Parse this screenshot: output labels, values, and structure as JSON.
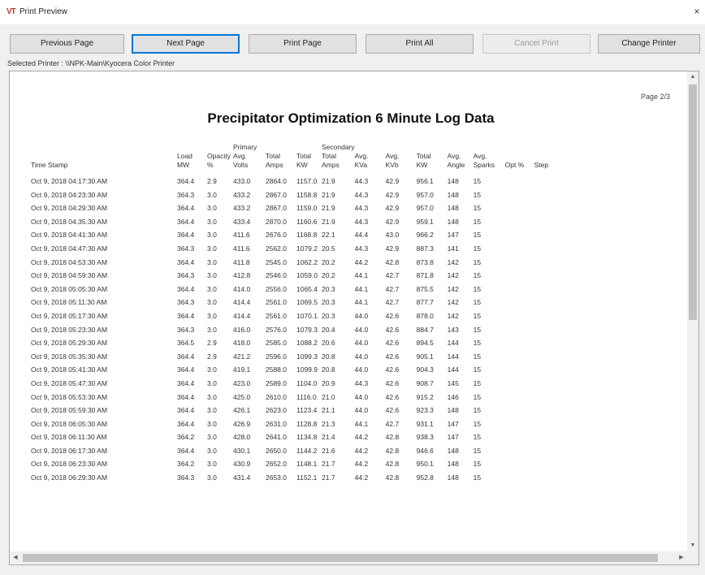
{
  "window": {
    "title": "Print Preview",
    "icon_text": "VT",
    "close_glyph": "×"
  },
  "toolbar": {
    "previous_label": "Previous Page",
    "next_label": "Next Page",
    "print_page_label": "Print Page",
    "print_all_label": "Print All",
    "cancel_print_label": "Cancel Print",
    "change_printer_label": "Change Printer"
  },
  "printer": {
    "selected_label": "Selected Printer : \\\\NPK-Main\\Kyocera Color Printer"
  },
  "report": {
    "page_label": "Page 2/3",
    "title": "Precipitator Optimization 6 Minute Log Data",
    "group_headers": {
      "primary": "Primary",
      "secondary": "Secondary"
    },
    "columns": [
      [
        "",
        "",
        "Time Stamp"
      ],
      [
        "",
        "Load",
        "MW"
      ],
      [
        "",
        "Opacity",
        "%"
      ],
      [
        "Primary",
        "Avg.",
        "Volts"
      ],
      [
        "",
        "Total",
        "Amps"
      ],
      [
        "",
        "Total",
        "KW"
      ],
      [
        "Secondary",
        "Total",
        "Amps"
      ],
      [
        "",
        "Avg.",
        "KVa"
      ],
      [
        "",
        "Avg.",
        "KVb"
      ],
      [
        "",
        "Total",
        "KW"
      ],
      [
        "",
        "Avg.",
        "Angle"
      ],
      [
        "",
        "Avg.",
        "Sparks"
      ],
      [
        "",
        "",
        "Opt %"
      ],
      [
        "",
        "",
        "Step"
      ]
    ],
    "rows": [
      [
        "Oct 9, 2018 04:17:30 AM",
        "364.4",
        "2.9",
        "433.0",
        "2864.0",
        "1157.0",
        "21.9",
        "44.3",
        "42.9",
        "956.1",
        "148",
        "15",
        "",
        ""
      ],
      [
        "Oct 9, 2018 04:23:30 AM",
        "364.3",
        "3.0",
        "433.2",
        "2867.0",
        "1158.8",
        "21.9",
        "44.3",
        "42.9",
        "957.0",
        "148",
        "15",
        "",
        ""
      ],
      [
        "Oct 9, 2018 04:29:30 AM",
        "364.4",
        "3.0",
        "433.2",
        "2867.0",
        "1159.0",
        "21.9",
        "44.3",
        "42.9",
        "957.0",
        "148",
        "15",
        "",
        ""
      ],
      [
        "Oct 9, 2018 04:35:30 AM",
        "364.4",
        "3.0",
        "433.4",
        "2870.0",
        "1160.6",
        "21.9",
        "44.3",
        "42.9",
        "959.1",
        "148",
        "15",
        "",
        ""
      ],
      [
        "Oct 9, 2018 04:41:30 AM",
        "364.4",
        "3.0",
        "411.6",
        "2676.0",
        "1168.8",
        "22.1",
        "44.4",
        "43.0",
        "966.2",
        "147",
        "15",
        "",
        ""
      ],
      [
        "Oct 9, 2018 04:47:30 AM",
        "364.3",
        "3.0",
        "411.6",
        "2562.0",
        "1079.2",
        "20.5",
        "44.3",
        "42.9",
        "887.3",
        "141",
        "15",
        "",
        ""
      ],
      [
        "Oct 9, 2018 04:53:30 AM",
        "364.4",
        "3.0",
        "411.8",
        "2545.0",
        "1062.2",
        "20.2",
        "44.2",
        "42.8",
        "873.8",
        "142",
        "15",
        "",
        ""
      ],
      [
        "Oct 9, 2018 04:59:30 AM",
        "364.3",
        "3.0",
        "412.8",
        "2546.0",
        "1059.0",
        "20.2",
        "44.1",
        "42.7",
        "871.8",
        "142",
        "15",
        "",
        ""
      ],
      [
        "Oct 9, 2018 05:05:30 AM",
        "364.4",
        "3.0",
        "414.0",
        "2556.0",
        "1065.4",
        "20.3",
        "44.1",
        "42.7",
        "875.5",
        "142",
        "15",
        "",
        ""
      ],
      [
        "Oct 9, 2018 05:11:30 AM",
        "364.3",
        "3.0",
        "414.4",
        "2561.0",
        "1069.5",
        "20.3",
        "44.1",
        "42.7",
        "877.7",
        "142",
        "15",
        "",
        ""
      ],
      [
        "Oct 9, 2018 05:17:30 AM",
        "364.4",
        "3.0",
        "414.4",
        "2561.0",
        "1070.1",
        "20.3",
        "44.0",
        "42.6",
        "878.0",
        "142",
        "15",
        "",
        ""
      ],
      [
        "Oct 9, 2018 05:23:30 AM",
        "364.3",
        "3.0",
        "416.0",
        "2576.0",
        "1079.3",
        "20.4",
        "44.0",
        "42.6",
        "884.7",
        "143",
        "15",
        "",
        ""
      ],
      [
        "Oct 9, 2018 05:29:30 AM",
        "364.5",
        "2.9",
        "418.0",
        "2585.0",
        "1088.2",
        "20.6",
        "44.0",
        "42.6",
        "894.5",
        "144",
        "15",
        "",
        ""
      ],
      [
        "Oct 9, 2018 05:35:30 AM",
        "364.4",
        "2.9",
        "421.2",
        "2596.0",
        "1099.3",
        "20.8",
        "44.0",
        "42.6",
        "905.1",
        "144",
        "15",
        "",
        ""
      ],
      [
        "Oct 9, 2018 05:41:30 AM",
        "364.4",
        "3.0",
        "419.1",
        "2588.0",
        "1099.9",
        "20.8",
        "44.0",
        "42.6",
        "904.3",
        "144",
        "15",
        "",
        ""
      ],
      [
        "Oct 9, 2018 05:47:30 AM",
        "364.4",
        "3.0",
        "423.0",
        "2589.0",
        "1104.0",
        "20.9",
        "44.3",
        "42.6",
        "908.7",
        "145",
        "15",
        "",
        ""
      ],
      [
        "Oct 9, 2018 05:53:30 AM",
        "364.4",
        "3.0",
        "425.0",
        "2610.0",
        "1116.0",
        "21.0",
        "44.0",
        "42.6",
        "915.2",
        "146",
        "15",
        "",
        ""
      ],
      [
        "Oct 9, 2018 05:59:30 AM",
        "364.4",
        "3.0",
        "426.1",
        "2623.0",
        "1123.4",
        "21.1",
        "44.0",
        "42.6",
        "923.3",
        "148",
        "15",
        "",
        ""
      ],
      [
        "Oct 9, 2018 06:05:30 AM",
        "364.4",
        "3.0",
        "426.9",
        "2631.0",
        "1128.8",
        "21.3",
        "44.1",
        "42.7",
        "931.1",
        "147",
        "15",
        "",
        ""
      ],
      [
        "Oct 9, 2018 06:11:30 AM",
        "364.2",
        "3.0",
        "428.0",
        "2641.0",
        "1134.8",
        "21.4",
        "44.2",
        "42.8",
        "938.3",
        "147",
        "15",
        "",
        ""
      ],
      [
        "Oct 9, 2018 06:17:30 AM",
        "364.4",
        "3.0",
        "430.1",
        "2650.0",
        "1144.2",
        "21.6",
        "44.2",
        "42.8",
        "946.6",
        "148",
        "15",
        "",
        ""
      ],
      [
        "Oct 9, 2018 06:23:30 AM",
        "364.2",
        "3.0",
        "430.9",
        "2652.0",
        "1148.1",
        "21.7",
        "44.2",
        "42.8",
        "950.1",
        "148",
        "15",
        "",
        ""
      ],
      [
        "Oct 9, 2018 06:29:30 AM",
        "364.3",
        "3.0",
        "431.4",
        "2653.0",
        "1152.1",
        "21.7",
        "44.2",
        "42.8",
        "952.8",
        "148",
        "15",
        "",
        ""
      ]
    ]
  },
  "scrollbars": {
    "up": "▲",
    "down": "▼",
    "left": "◀",
    "right": "▶"
  }
}
